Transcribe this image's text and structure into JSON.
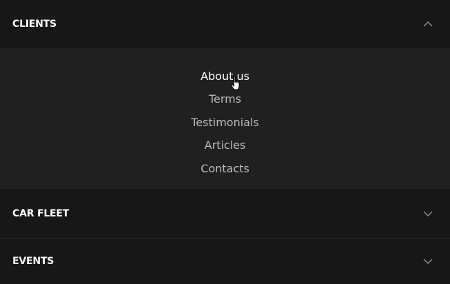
{
  "accordion": {
    "sections": [
      {
        "title": "CLIENTS",
        "expanded": true,
        "items": [
          {
            "label": "About us",
            "active": true
          },
          {
            "label": "Terms"
          },
          {
            "label": "Testimonials"
          },
          {
            "label": "Articles"
          },
          {
            "label": "Contacts"
          }
        ]
      },
      {
        "title": "CAR FLEET",
        "expanded": false
      },
      {
        "title": "EVENTS",
        "expanded": false
      }
    ]
  },
  "icons": {
    "expanded": "chevron-up-icon",
    "collapsed": "chevron-down-icon",
    "cursor": "hand-pointer-cursor"
  },
  "colors": {
    "background": "#161616",
    "panel": "#202020",
    "text_active": "#ffffff",
    "text_inactive": "#bdbdbd",
    "chevron": "#8a8a8a"
  }
}
